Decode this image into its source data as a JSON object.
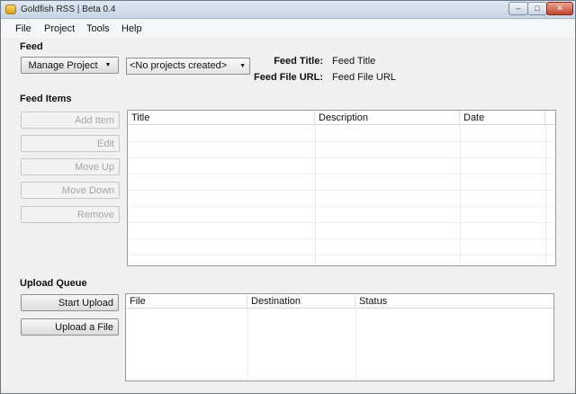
{
  "window": {
    "title": "Goldfish RSS | Beta 0.4",
    "min": "–",
    "max": "□",
    "close": "✕"
  },
  "menu": [
    "File",
    "Project",
    "Tools",
    "Help"
  ],
  "feed": {
    "section": "Feed",
    "manage_project": "Manage Project",
    "project_select": "<No projects created>",
    "title_label": "Feed Title:",
    "title_value": "Feed Title",
    "url_label": "Feed File URL:",
    "url_value": "Feed File URL"
  },
  "feed_items": {
    "section": "Feed Items",
    "buttons": [
      "Add Item",
      "Edit",
      "Move Up",
      "Move Down",
      "Remove"
    ],
    "columns": [
      "Title",
      "Description",
      "Date"
    ]
  },
  "upload_queue": {
    "section": "Upload Queue",
    "buttons": [
      "Start Upload",
      "Upload a File"
    ],
    "columns": [
      "File",
      "Destination",
      "Status"
    ]
  },
  "icons": {
    "dropdown": "▼"
  }
}
